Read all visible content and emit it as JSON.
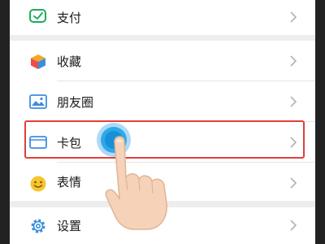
{
  "menu": {
    "items": [
      {
        "label": "支付",
        "icon": "pay-icon"
      },
      {
        "label": "收藏",
        "icon": "favorites-cube-icon"
      },
      {
        "label": "朋友圈",
        "icon": "moments-photo-icon"
      },
      {
        "label": "卡包",
        "icon": "card-wallet-icon"
      },
      {
        "label": "表情",
        "icon": "smiley-icon"
      },
      {
        "label": "设置",
        "icon": "settings-gear-icon"
      }
    ]
  },
  "colors": {
    "pay_green": "#1aad5a",
    "highlight_red": "#e0403c",
    "tap_blue": "#2fa8e8",
    "background": "#ededed"
  }
}
